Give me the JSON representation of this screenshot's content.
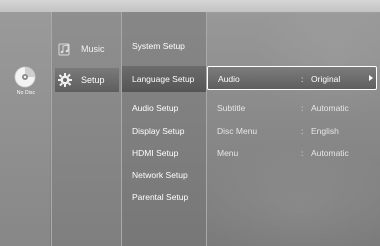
{
  "disc_status": {
    "label": "No Disc"
  },
  "main_menu": {
    "items": [
      {
        "label": "Music",
        "icon": "music-icon"
      },
      {
        "label": "Setup",
        "icon": "gear-icon"
      }
    ]
  },
  "setup_menu": {
    "items": [
      {
        "label": "System Setup"
      },
      {
        "label": "Language Setup"
      },
      {
        "label": "Audio Setup"
      },
      {
        "label": "Display Setup"
      },
      {
        "label": "HDMI Setup"
      },
      {
        "label": "Network Setup"
      },
      {
        "label": "Parental Setup"
      }
    ]
  },
  "language_options": {
    "rows": [
      {
        "name": "Audio",
        "sep": ":",
        "value": "Original"
      },
      {
        "name": "Subtitle",
        "sep": ":",
        "value": "Automatic"
      },
      {
        "name": "Disc Menu",
        "sep": ":",
        "value": "English"
      },
      {
        "name": "Menu",
        "sep": ":",
        "value": "Automatic"
      }
    ]
  },
  "colors": {
    "text": "#ffffff",
    "highlight_border": "#ffffff"
  }
}
